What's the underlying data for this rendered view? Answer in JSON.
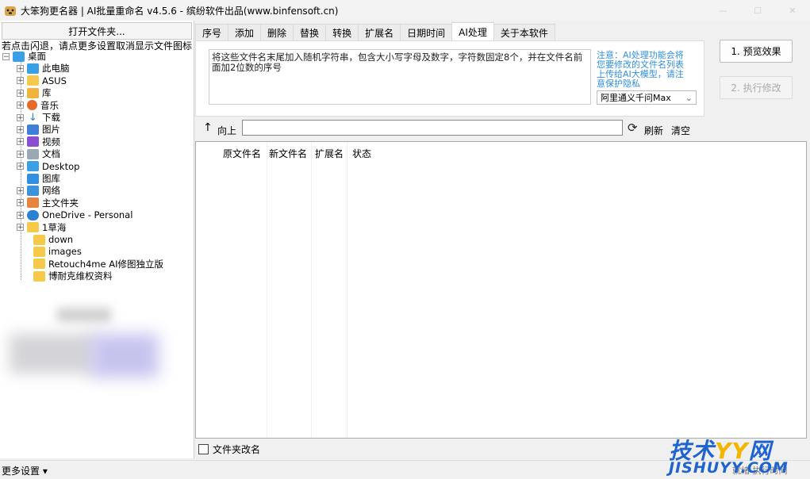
{
  "window": {
    "title": "大笨狗更名器 | AI批量重命名 v4.5.6 - 缤纷软件出品(www.binfensoft.cn)"
  },
  "left": {
    "open_folder_label": "打开文件夹...",
    "hint": "若点击闪退，请点更多设置取消显示文件图标",
    "tree": [
      {
        "label": "桌面",
        "icon": "desktop"
      },
      {
        "label": "此电脑",
        "icon": "pc"
      },
      {
        "label": "ASUS",
        "icon": "folder"
      },
      {
        "label": "库",
        "icon": "lib"
      },
      {
        "label": "音乐",
        "icon": "music"
      },
      {
        "label": "下载",
        "icon": "dl"
      },
      {
        "label": "图片",
        "icon": "pic"
      },
      {
        "label": "视频",
        "icon": "video"
      },
      {
        "label": "文档",
        "icon": "doc"
      },
      {
        "label": "Desktop",
        "icon": "desktop"
      },
      {
        "label": "图库",
        "icon": "gallery"
      },
      {
        "label": "网络",
        "icon": "net"
      },
      {
        "label": "主文件夹",
        "icon": "home"
      },
      {
        "label": "OneDrive - Personal",
        "icon": "cloud"
      },
      {
        "label": "1草海",
        "icon": "folder"
      },
      {
        "label": "down",
        "icon": "folder"
      },
      {
        "label": "images",
        "icon": "folder"
      },
      {
        "label": "Retouch4me AI修图独立版",
        "icon": "folder"
      },
      {
        "label": "博耐克维权资料",
        "icon": "folder"
      }
    ]
  },
  "tabs": [
    "序号",
    "添加",
    "删除",
    "替换",
    "转换",
    "扩展名",
    "日期时间",
    "AI处理",
    "关于本软件"
  ],
  "active_tab": "AI处理",
  "ai": {
    "prompt": "将这些文件名末尾加入随机字符串，包含大小写字母及数字，字符数固定8个，并在文件名前面加2位数的序号",
    "note": "注意：AI处理功能会将您要修改的文件名列表上传给AI大模型，请注意保护隐私",
    "model": "阿里通义千问Max"
  },
  "actions": {
    "preview": "1. 预览效果",
    "execute": "2. 执行修改"
  },
  "pathbar": {
    "up": "向上",
    "path": "",
    "refresh": "刷新",
    "clear": "清空"
  },
  "columns": [
    "原文件名",
    "新文件名",
    "扩展名",
    "状态"
  ],
  "folder_rename": "文件夹改名",
  "status": {
    "more_settings": "更多设置",
    "right": "就绪  执行时间"
  },
  "watermark": {
    "main": "技术YY网",
    "sub": "JISHUYY.COM"
  },
  "colors": {
    "note": "#2f8fe0",
    "watermark_blue": "#1f63d0",
    "watermark_yellow": "#f5b400"
  }
}
